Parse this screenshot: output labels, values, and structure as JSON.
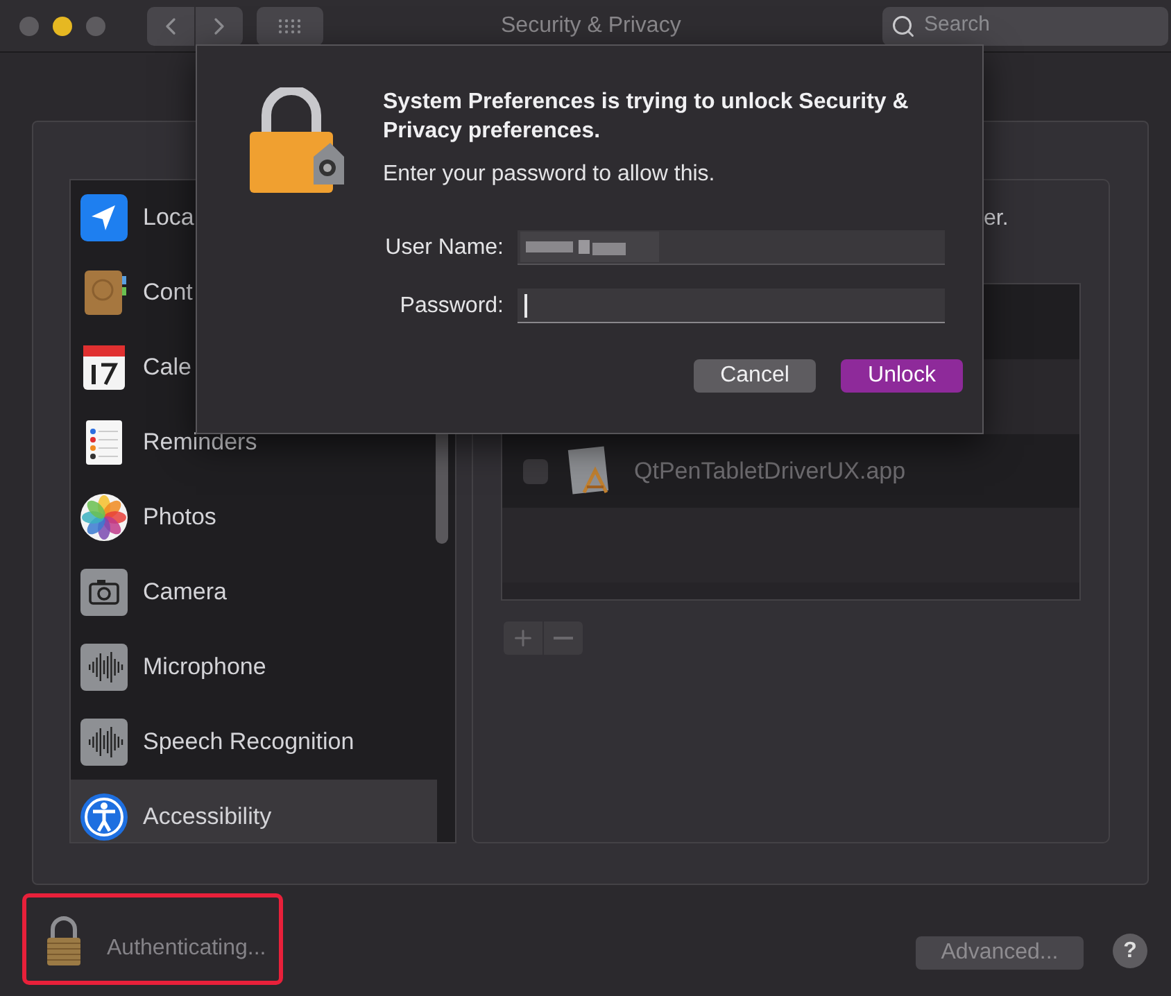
{
  "window": {
    "title": "Security & Privacy",
    "search": {
      "placeholder": "Search"
    },
    "lights": [
      {
        "color": "#5d5b5f"
      },
      {
        "color": "#e6b822"
      },
      {
        "color": "#5d5b5f"
      }
    ]
  },
  "sidebar": {
    "items": [
      {
        "label": "Loca",
        "selected": false
      },
      {
        "label": "Cont",
        "selected": false
      },
      {
        "label": "Cale",
        "selected": false
      },
      {
        "label": "Reminders",
        "selected": false
      },
      {
        "label": "Photos",
        "selected": false
      },
      {
        "label": "Camera",
        "selected": false
      },
      {
        "label": "Microphone",
        "selected": false
      },
      {
        "label": "Speech Recognition",
        "selected": false
      },
      {
        "label": "Accessibility",
        "selected": true
      }
    ]
  },
  "panel": {
    "note": "er.",
    "apps": [
      {
        "label": "QtPenTabletDriverUX.app",
        "checked": false
      }
    ]
  },
  "lock_status": {
    "text": "Authenticating...",
    "highlighted": true
  },
  "advanced_button": "Advanced...",
  "help_button": "?",
  "dialog": {
    "title": "System Preferences is trying to unlock Security & Privacy preferences.",
    "message": "Enter your password to allow this.",
    "fields": [
      {
        "label": "User Name:",
        "kind": "redacted",
        "focused": false
      },
      {
        "label": "Password:",
        "kind": "secure",
        "focused": true
      }
    ],
    "buttons": [
      {
        "label": "Cancel",
        "kind": "secondary"
      },
      {
        "label": "Unlock",
        "kind": "default"
      }
    ]
  }
}
